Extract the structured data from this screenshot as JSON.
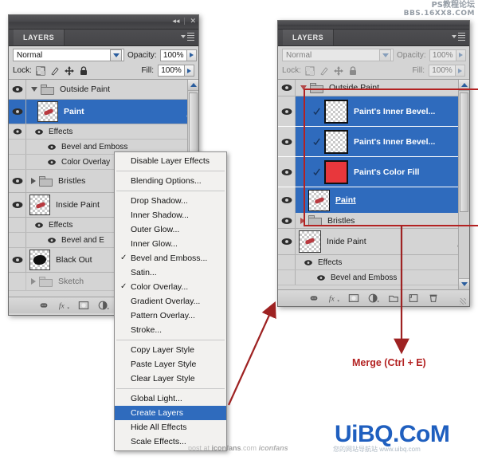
{
  "left_panel": {
    "titlebar": {
      "collapse_icon": "◂◂",
      "close_icon": "✕"
    },
    "tab_label": "LAYERS",
    "blend_mode": "Normal",
    "opacity_label": "Opacity:",
    "opacity_value": "100%",
    "lock_label": "Lock:",
    "fill_label": "Fill:",
    "fill_value": "100%",
    "lock_icons": [
      "lock-transparent-pixels",
      "lock-image-pixels",
      "lock-position",
      "lock-all"
    ],
    "layers": [
      {
        "name": "Outside Paint",
        "type": "group",
        "expanded": true,
        "selected": false,
        "visible": true
      },
      {
        "name": "Paint",
        "type": "layer",
        "selected": true,
        "visible": true,
        "has_fx": true
      },
      {
        "name": "Effects",
        "type": "effects",
        "visible": true
      },
      {
        "name": "Bevel and Emboss",
        "type": "effect",
        "visible": true
      },
      {
        "name": "Color Overlay",
        "type": "effect",
        "visible": true
      },
      {
        "name": "Bristles",
        "type": "group",
        "expanded": false,
        "visible": true
      },
      {
        "name": "Inside Paint",
        "type": "layer",
        "visible": true
      },
      {
        "name": "Effects",
        "type": "effects",
        "visible": true
      },
      {
        "name": "Bevel and E",
        "type": "effect",
        "visible": true
      },
      {
        "name": "Black Out",
        "type": "layer",
        "visible": true
      },
      {
        "name": "Sketch",
        "type": "group",
        "expanded": false,
        "visible": false
      }
    ]
  },
  "context_menu": {
    "items": [
      {
        "label": "Disable Layer Effects",
        "checked": false,
        "highlight": false,
        "sep_after": true
      },
      {
        "label": "Blending Options...",
        "checked": false,
        "highlight": false,
        "sep_after": true
      },
      {
        "label": "Drop Shadow...",
        "checked": false,
        "highlight": false
      },
      {
        "label": "Inner Shadow...",
        "checked": false,
        "highlight": false
      },
      {
        "label": "Outer Glow...",
        "checked": false,
        "highlight": false
      },
      {
        "label": "Inner Glow...",
        "checked": false,
        "highlight": false
      },
      {
        "label": "Bevel and Emboss...",
        "checked": true,
        "highlight": false
      },
      {
        "label": "Satin...",
        "checked": false,
        "highlight": false
      },
      {
        "label": "Color Overlay...",
        "checked": true,
        "highlight": false
      },
      {
        "label": "Gradient Overlay...",
        "checked": false,
        "highlight": false
      },
      {
        "label": "Pattern Overlay...",
        "checked": false,
        "highlight": false
      },
      {
        "label": "Stroke...",
        "checked": false,
        "highlight": false,
        "sep_after": true
      },
      {
        "label": "Copy Layer Style",
        "checked": false,
        "highlight": false
      },
      {
        "label": "Paste Layer Style",
        "checked": false,
        "highlight": false
      },
      {
        "label": "Clear Layer Style",
        "checked": false,
        "highlight": false,
        "sep_after": true
      },
      {
        "label": "Global Light...",
        "checked": false,
        "highlight": false
      },
      {
        "label": "Create Layers",
        "checked": false,
        "highlight": true
      },
      {
        "label": "Hide All Effects",
        "checked": false,
        "highlight": false
      },
      {
        "label": "Scale Effects...",
        "checked": false,
        "highlight": false
      }
    ]
  },
  "right_panel": {
    "tab_label": "LAYERS",
    "blend_mode": "Normal",
    "opacity_label": "Opacity:",
    "opacity_value": "100%",
    "lock_label": "Lock:",
    "fill_label": "Fill:",
    "fill_value": "100%",
    "layers": [
      {
        "name": "Outside Paint",
        "type": "group",
        "expanded": true,
        "selected": false,
        "visible": true
      },
      {
        "name": "Paint's Inner Bevel...",
        "type": "layer",
        "selected": true,
        "visible": true,
        "clipped": true
      },
      {
        "name": "Paint's Inner Bevel...",
        "type": "layer",
        "selected": true,
        "visible": true,
        "clipped": true
      },
      {
        "name": "Paint's Color Fill",
        "type": "layer",
        "selected": true,
        "visible": true,
        "clipped": true,
        "thumb": "red"
      },
      {
        "name": "Paint",
        "type": "layer",
        "selected": true,
        "visible": true,
        "underlined": true
      },
      {
        "name": "Bristles",
        "type": "group",
        "expanded": false,
        "visible": true
      },
      {
        "name": "Inide Paint",
        "type": "layer",
        "visible": true,
        "has_fx": true
      },
      {
        "name": "Effects",
        "type": "effects",
        "visible": true
      },
      {
        "name": "Bevel and Emboss",
        "type": "effect",
        "visible": true
      }
    ]
  },
  "annotations": {
    "merge_label": "Merge (Ctrl + E)",
    "accent_color": "#b32222"
  },
  "watermarks": {
    "cn_line1": "PS教程论坛",
    "cn_line2": "BBS.16XX8.COM",
    "uibq": "UiBQ.CoM",
    "uibq_sub": "您的网站导航站 www.uibq.com",
    "iconfans_prefix": "post at ",
    "iconfans_name": "iconfans",
    "iconfans_suffix": ".com",
    "iconfans_brand": "iconfans"
  }
}
